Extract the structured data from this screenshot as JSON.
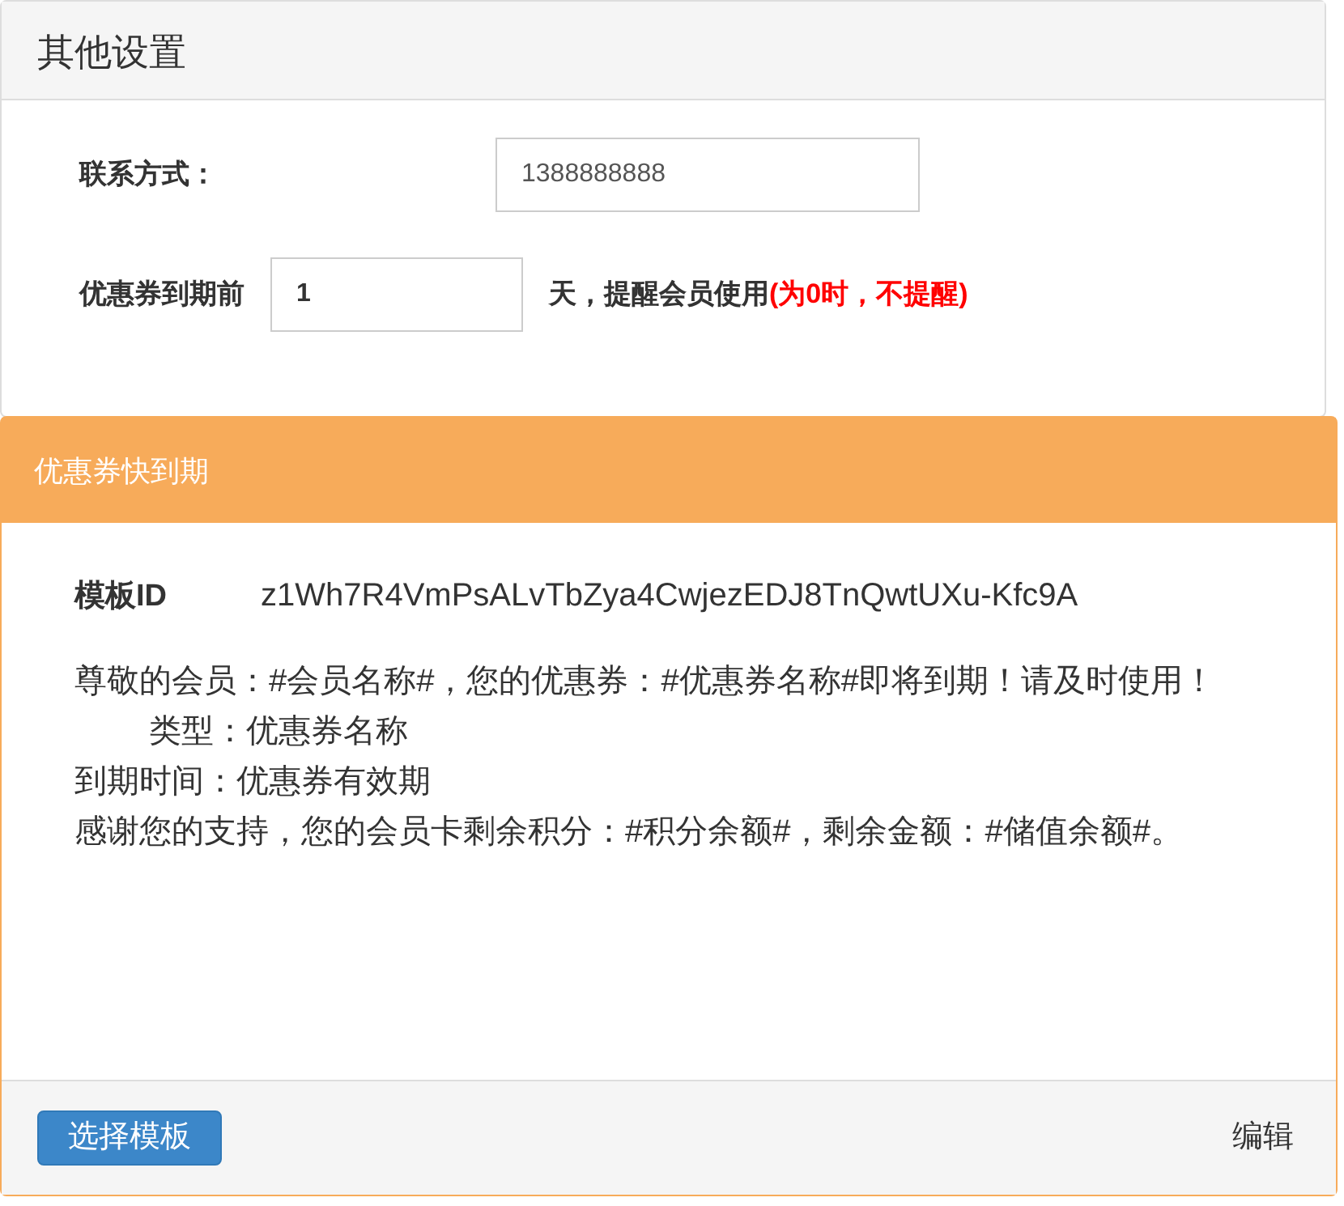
{
  "settings_panel": {
    "title": "其他设置",
    "contact": {
      "label": "联系方式：",
      "value": "1388888888"
    },
    "reminder": {
      "label": "优惠券到期前",
      "value": "1",
      "suffix": "天，提醒会员使用",
      "note": "(为0时，不提醒)"
    }
  },
  "template_panel": {
    "title": "优惠券快到期",
    "id_label": "模板ID",
    "id_value": "z1Wh7R4VmPsALvTbZya4CwjezEDJ8TnQwtUXu-Kfc9A",
    "message_lines": [
      {
        "text": "尊敬的会员：#会员名称#，您的优惠券：#优惠券名称#即将到期！请及时使用！",
        "indented": false
      },
      {
        "text": "类型：优惠券名称",
        "indented": true
      },
      {
        "text": "到期时间：优惠券有效期",
        "indented": false
      },
      {
        "text": "感谢您的支持，您的会员卡剩余积分：#积分余额#，剩余金额：#储值余额#。",
        "indented": false
      }
    ],
    "select_button": "选择模板",
    "edit_link": "编辑"
  }
}
